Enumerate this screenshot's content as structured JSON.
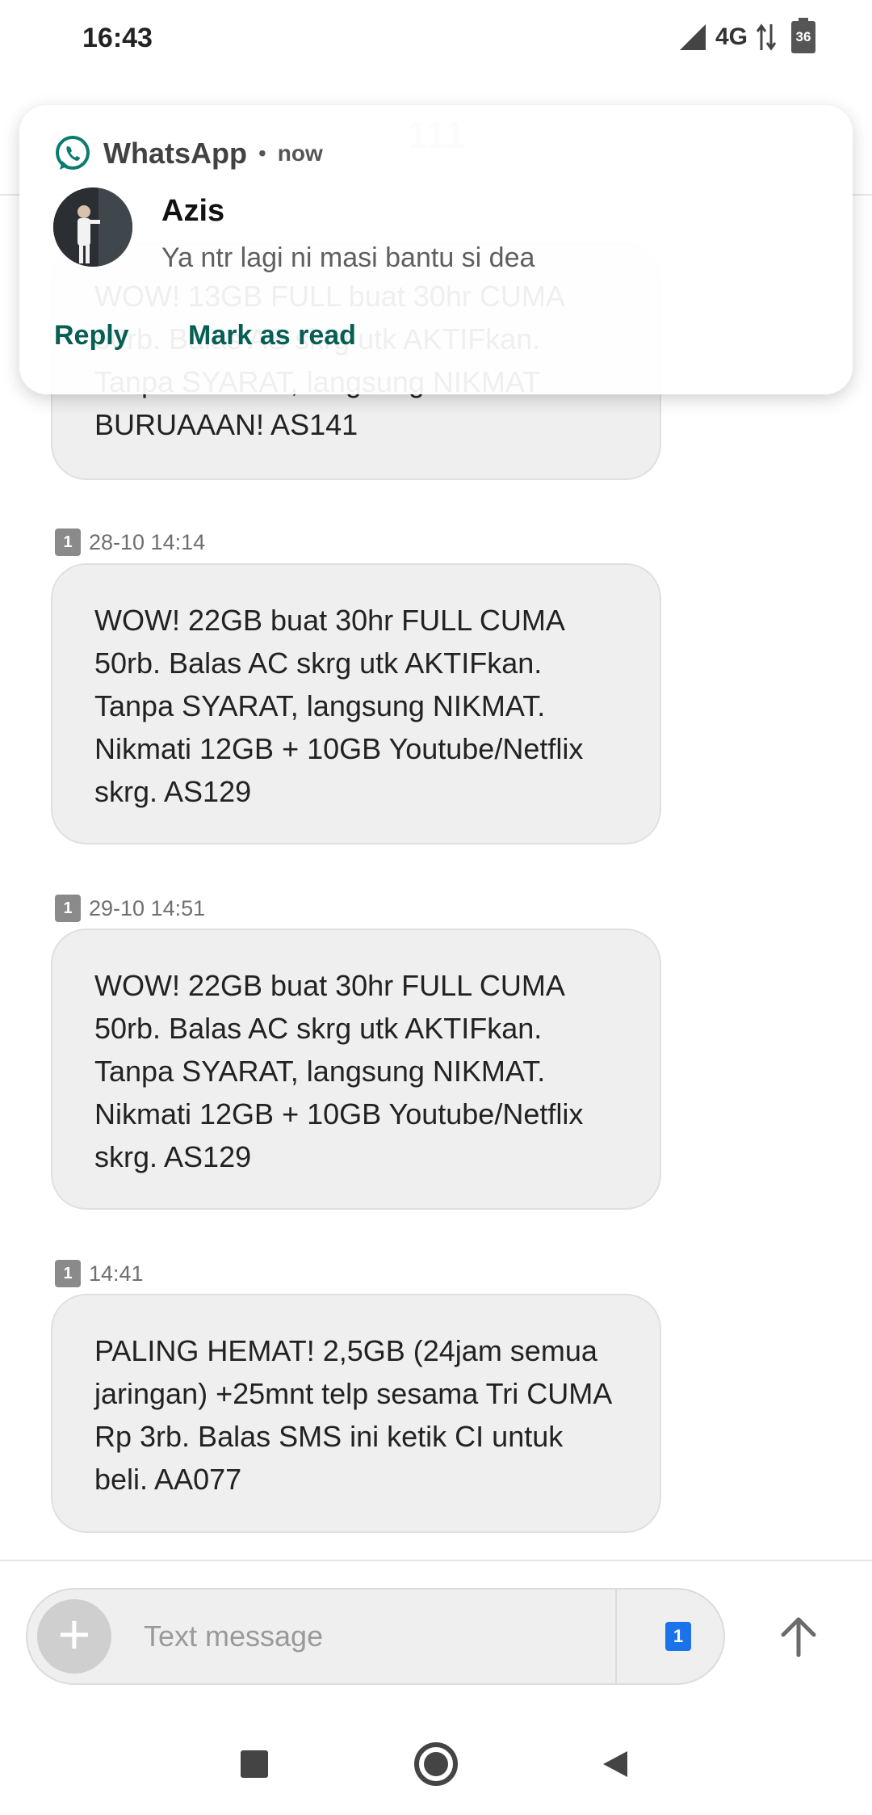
{
  "status_bar": {
    "time": "16:43",
    "network": "4G",
    "battery_level": "36",
    "icons": [
      "signal-icon",
      "data-arrows-icon",
      "battery-icon"
    ]
  },
  "header": {
    "title": "111",
    "back_icon": "back-arrow-icon"
  },
  "notification": {
    "app_name": "WhatsApp",
    "separator": "•",
    "time": "now",
    "sender": "Azis",
    "message": "Ya ntr lagi ni masi bantu si dea",
    "actions": {
      "reply": "Reply",
      "mark_read": "Mark as read"
    },
    "accent_color": "#075e54"
  },
  "messages": [
    {
      "sim": "1",
      "time": "",
      "text": "WOW! 13GB FULL buat 30hr CUMA 50rb. Balas AS skrg utk AKTIFkan. Tanpa SYARAT, langsung NIKMAT BURUAAAN! AS141"
    },
    {
      "sim": "1",
      "time": "28-10 14:14",
      "text": "WOW! 22GB buat 30hr FULL CUMA 50rb. Balas AC skrg utk AKTIFkan. Tanpa SYARAT, langsung NIKMAT. Nikmati 12GB + 10GB Youtube/Netflix skrg. AS129"
    },
    {
      "sim": "1",
      "time": "29-10 14:51",
      "text": "WOW! 22GB buat 30hr FULL CUMA 50rb. Balas AC skrg utk AKTIFkan. Tanpa SYARAT, langsung NIKMAT. Nikmati 12GB + 10GB Youtube/Netflix skrg. AS129"
    },
    {
      "sim": "1",
      "time": "14:41",
      "text": "PALING HEMAT! 2,5GB (24jam semua jaringan) +25mnt telp sesama Tri CUMA Rp 3rb. Balas SMS ini ketik CI untuk beli. AA077"
    }
  ],
  "compose": {
    "placeholder": "Text message",
    "sim_label": "1",
    "sim_color": "#1a73e8"
  },
  "nav": {
    "icons": [
      "recents-square-icon",
      "home-circle-icon",
      "back-triangle-icon"
    ]
  }
}
